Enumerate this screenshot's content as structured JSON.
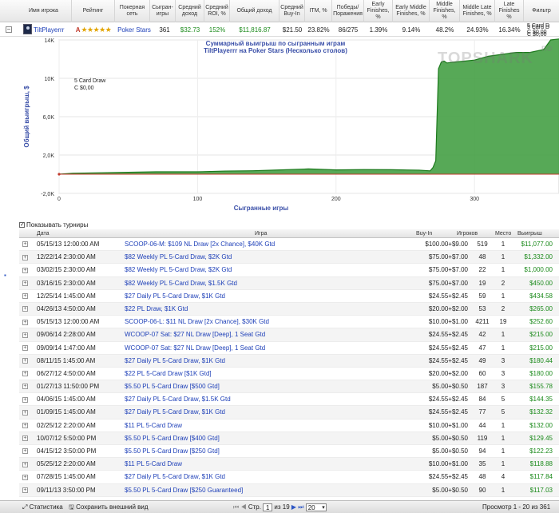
{
  "header": {
    "columns": [
      "Имя игрока",
      "Рейтинг",
      "Покерная сеть",
      "Сыгран- игры",
      "Средний доход",
      "Средний ROI, %",
      "Общий доход",
      "Средний Buy-In",
      "ITM, %",
      "Победы/ Поражения",
      "Early Finishes, %",
      "Early Middle Finishes, %",
      "Middle Finishes, %",
      "Middle Late Finishes, %",
      "Late Finishes %",
      "Фильтр"
    ]
  },
  "player": {
    "name": "TiltPlayerrr",
    "rank_letter": "A",
    "stars": "★★★★★",
    "network": "Poker Stars",
    "games": "361",
    "avg_profit": "$32.73",
    "avg_roi": "152%",
    "total_profit": "$11,816.87",
    "avg_buyin": "$21.50",
    "itm": "23.82%",
    "wins_losses": "86/275",
    "early": "1.39%",
    "early_middle": "9.14%",
    "middle": "48.2%",
    "middle_late": "24.93%",
    "late": "16.34%",
    "filter": "5 Card D",
    "filter2": "C $0,00"
  },
  "chart": {
    "title1": "Суммарный выигрыш по сыгранным играм",
    "title2": "TiltPlayerrr на Poker Stars (Несколько столов)",
    "watermark": "TOPSHARK",
    "watermark_suffix": "RO",
    "legend_left": "5 Card Draw",
    "legend_left2": "C $0,00",
    "legend_right": "5 Card D",
    "legend_right2": "C $0,00",
    "y_tick_labels": [
      "14K",
      "10K",
      "6,0K",
      "2,0K",
      "-2,0K"
    ],
    "x_tick_labels": [
      "0",
      "100",
      "200",
      "300"
    ],
    "colors": {
      "area": "#3a9a3a",
      "line": "#1d7a1d",
      "zero_line": "#c0392b"
    }
  },
  "chart_data": {
    "type": "area",
    "title": "Суммарный выигрыш по сыгранным играм",
    "subtitle": "TiltPlayerrr на Poker Stars (Несколько столов)",
    "xlabel": "Сыгранные игры",
    "ylabel": "Общий выигрыш, $",
    "xlim": [
      0,
      361
    ],
    "ylim": [
      -2000,
      14000
    ],
    "grid": true,
    "series": [
      {
        "name": "5 Card Draw",
        "x": [
          0,
          10,
          30,
          50,
          70,
          100,
          120,
          140,
          160,
          180,
          200,
          220,
          240,
          260,
          268,
          270,
          272,
          274,
          276,
          278,
          280,
          286,
          300,
          310,
          320,
          330,
          340,
          350,
          355,
          361
        ],
        "y": [
          0,
          100,
          150,
          200,
          250,
          250,
          330,
          360,
          450,
          550,
          450,
          480,
          470,
          420,
          350,
          700,
          1400,
          11000,
          11700,
          11800,
          11600,
          11700,
          11900,
          12300,
          12500,
          12700,
          12700,
          13000,
          14000,
          14100
        ]
      }
    ]
  },
  "tournaments": {
    "show_label": "Показывать турниры",
    "columns": {
      "date": "Дата",
      "game": "Игра",
      "buyin": "Buy-In",
      "players": "Игроков",
      "place": "Место",
      "winnings": "Выигрыш"
    },
    "rows": [
      [
        "05/15/13 12:00:00 AM",
        "SCOOP-06-M: $109 NL Draw [2x Chance], $40K Gtd",
        "$100.00+$9.00",
        "519",
        "1",
        "$11,077.00"
      ],
      [
        "12/22/14 2:30:00 AM",
        "$82 Weekly PL 5-Card Draw, $2K Gtd",
        "$75.00+$7.00",
        "48",
        "1",
        "$1,332.00"
      ],
      [
        "03/02/15 2:30:00 AM",
        "$82 Weekly PL 5-Card Draw, $2K Gtd",
        "$75.00+$7.00",
        "22",
        "1",
        "$1,000.00"
      ],
      [
        "03/16/15 2:30:00 AM",
        "$82 Weekly PL 5-Card Draw, $1.5K Gtd",
        "$75.00+$7.00",
        "19",
        "2",
        "$450.00"
      ],
      [
        "12/25/14 1:45:00 AM",
        "$27 Daily PL 5-Card Draw, $1K Gtd",
        "$24.55+$2.45",
        "59",
        "1",
        "$434.58"
      ],
      [
        "04/26/13 4:50:00 AM",
        "$22 PL Draw, $1K Gtd",
        "$20.00+$2.00",
        "53",
        "2",
        "$265.00"
      ],
      [
        "05/15/13 12:00:00 AM",
        "SCOOP-06-L: $11 NL Draw [2x Chance], $30K Gtd",
        "$10.00+$1.00",
        "4211",
        "19",
        "$252.60"
      ],
      [
        "09/06/14 2:28:00 AM",
        "WCOOP-07 Sat: $27 NL Draw [Deep], 1 Seat Gtd",
        "$24.55+$2.45",
        "42",
        "1",
        "$215.00"
      ],
      [
        "09/09/14 1:47:00 AM",
        "WCOOP-07 Sat: $27 NL Draw [Deep], 1 Seat Gtd",
        "$24.55+$2.45",
        "47",
        "1",
        "$215.00"
      ],
      [
        "08/11/15 1:45:00 AM",
        "$27 Daily PL 5-Card Draw, $1K Gtd",
        "$24.55+$2.45",
        "49",
        "3",
        "$180.44"
      ],
      [
        "06/27/12 4:50:00 AM",
        "$22 PL 5-Card Draw [$1K Gtd]",
        "$20.00+$2.00",
        "60",
        "3",
        "$180.00"
      ],
      [
        "01/27/13 11:50:00 PM",
        "$5.50 PL 5-Card Draw [$500 Gtd]",
        "$5.00+$0.50",
        "187",
        "3",
        "$155.78"
      ],
      [
        "04/06/15 1:45:00 AM",
        "$27 Daily PL 5-Card Draw, $1.5K Gtd",
        "$24.55+$2.45",
        "84",
        "5",
        "$144.35"
      ],
      [
        "01/09/15 1:45:00 AM",
        "$27 Daily PL 5-Card Draw, $1K Gtd",
        "$24.55+$2.45",
        "77",
        "5",
        "$132.32"
      ],
      [
        "02/25/12 2:20:00 AM",
        "$11 PL 5-Card Draw",
        "$10.00+$1.00",
        "44",
        "1",
        "$132.00"
      ],
      [
        "10/07/12 5:50:00 PM",
        "$5.50 PL 5-Card Draw [$400 Gtd]",
        "$5.00+$0.50",
        "119",
        "1",
        "$129.45"
      ],
      [
        "04/15/12 3:50:00 PM",
        "$5.50 PL 5-Card Draw [$250 Gtd]",
        "$5.00+$0.50",
        "94",
        "1",
        "$122.23"
      ],
      [
        "05/25/12 2:20:00 AM",
        "$11 PL 5-Card Draw",
        "$10.00+$1.00",
        "35",
        "1",
        "$118.88"
      ],
      [
        "07/28/15 1:45:00 AM",
        "$27 Daily PL 5-Card Draw, $1K Gtd",
        "$24.55+$2.45",
        "48",
        "4",
        "$117.84"
      ],
      [
        "09/11/13 3:50:00 PM",
        "$5.50 PL 5-Card Draw [$250 Guaranteed]",
        "$5.00+$0.50",
        "90",
        "1",
        "$117.03"
      ]
    ]
  },
  "footer": {
    "stats": "Статистика",
    "save_view": "Сохранить внешний вид",
    "page_label": "Стр.",
    "page": "1",
    "of_pages": "из 19",
    "page_size": "20",
    "summary": "Просмотр 1 - 20 из 361"
  }
}
